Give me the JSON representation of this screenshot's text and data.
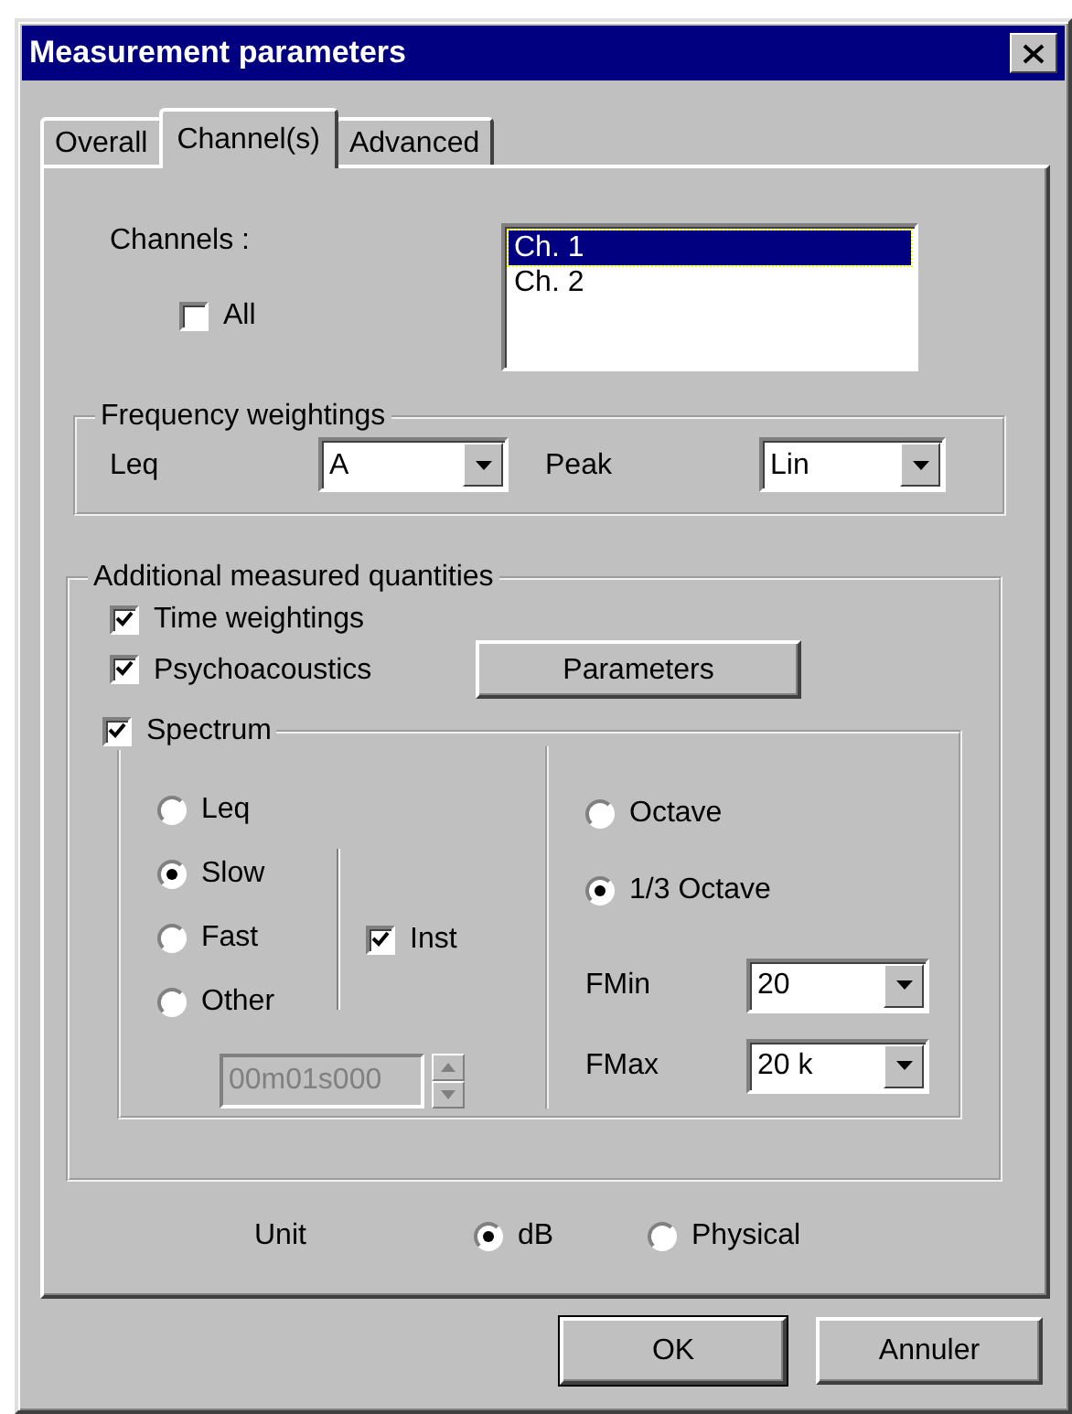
{
  "window": {
    "title": "Measurement parameters"
  },
  "tabs": [
    {
      "label": "Overall",
      "selected": false
    },
    {
      "label": "Channel(s)",
      "selected": true
    },
    {
      "label": "Advanced",
      "selected": false
    }
  ],
  "channels": {
    "label": "Channels :",
    "all": {
      "label": "All",
      "checked": false
    },
    "list": [
      {
        "label": "Ch. 1",
        "selected": true
      },
      {
        "label": "Ch. 2",
        "selected": false
      }
    ]
  },
  "frequency_weightings": {
    "title": "Frequency weightings",
    "fields": [
      {
        "label": "Leq",
        "value": "A"
      },
      {
        "label": "Peak",
        "value": "Lin"
      }
    ]
  },
  "additional": {
    "title": "Additional measured quantities",
    "options": [
      {
        "label": "Time weightings",
        "checked": true
      },
      {
        "label": "Psychoacoustics",
        "checked": true
      }
    ],
    "parameters_button": "Parameters",
    "spectrum": {
      "label": "Spectrum",
      "checked": true,
      "modes": [
        {
          "label": "Leq",
          "selected": false
        },
        {
          "label": "Slow",
          "selected": true
        },
        {
          "label": "Fast",
          "selected": false
        },
        {
          "label": "Other",
          "selected": false
        }
      ],
      "inst": {
        "label": "Inst",
        "checked": true
      },
      "time": {
        "value": "00m01s000",
        "disabled": true
      },
      "bands": [
        {
          "label": "Octave",
          "selected": false
        },
        {
          "label": "1/3 Octave",
          "selected": true
        }
      ],
      "limits": [
        {
          "label": "FMin",
          "value": "20"
        },
        {
          "label": "FMax",
          "value": "20 k"
        }
      ]
    }
  },
  "unit": {
    "label": "Unit",
    "options": [
      {
        "label": "dB",
        "selected": true
      },
      {
        "label": "Physical",
        "selected": false
      }
    ]
  },
  "buttons": [
    {
      "label": "OK",
      "default": true
    },
    {
      "label": "Annuler",
      "default": false
    }
  ]
}
